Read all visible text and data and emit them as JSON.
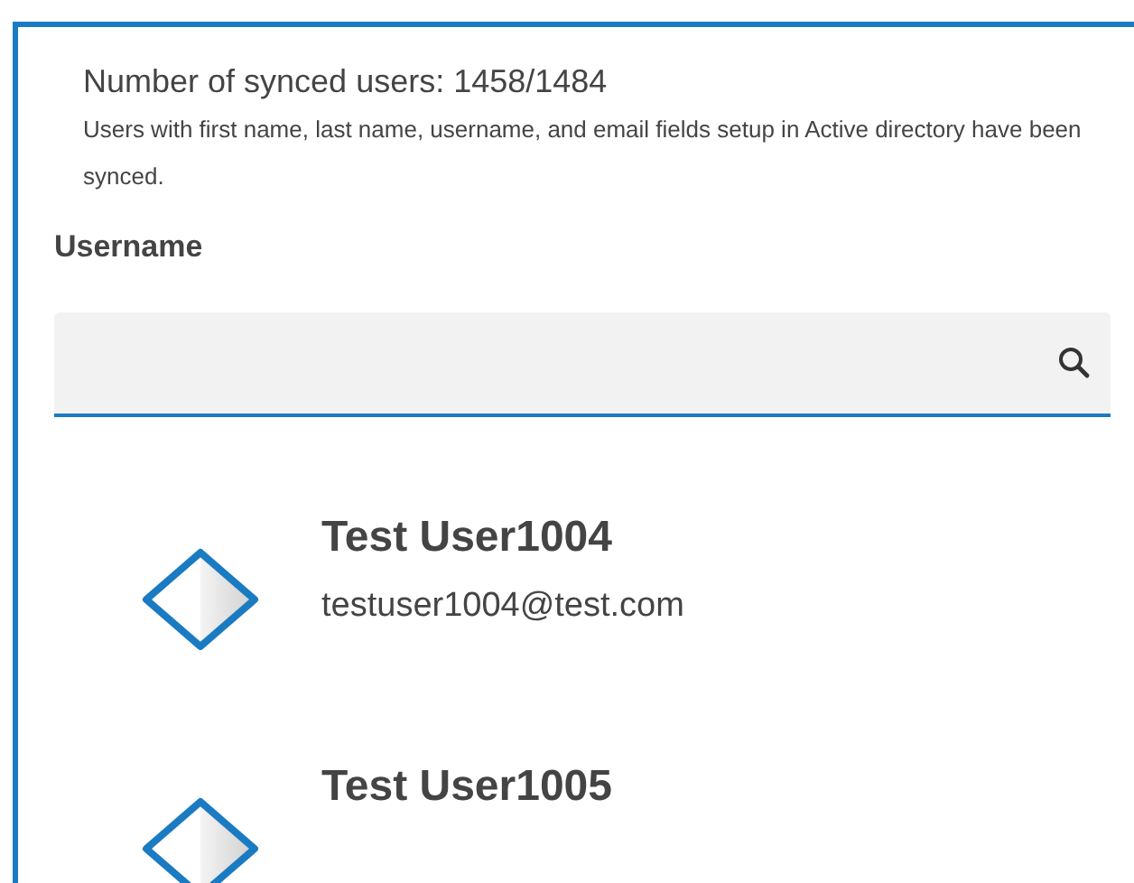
{
  "sync_summary": {
    "title": "Number of synced users: 1458/1484",
    "description": "Users with first name, last name, username, and email fields setup in Active directory have been synced."
  },
  "search": {
    "label": "Username"
  },
  "users": [
    {
      "name": "Test User1004",
      "email": "testuser1004@test.com"
    },
    {
      "name": "Test User1005"
    }
  ]
}
